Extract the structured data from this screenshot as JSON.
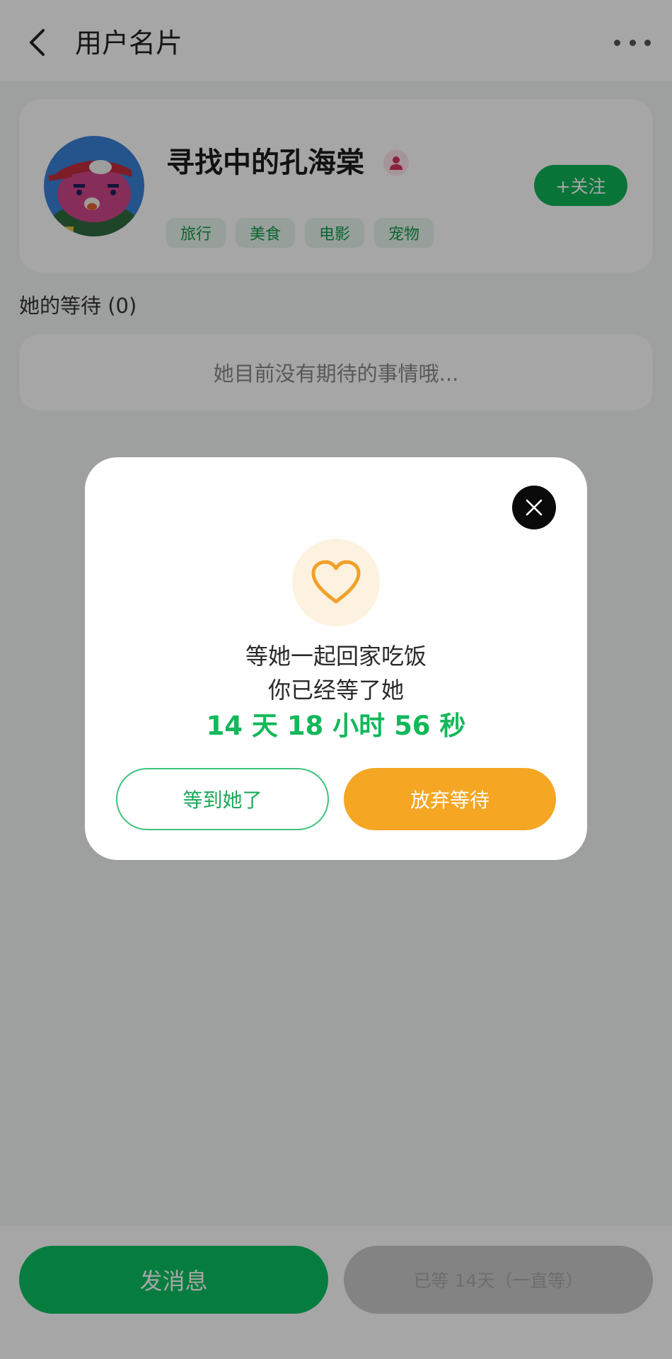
{
  "header": {
    "title": "用户名片",
    "back_icon": "chevron-left-icon",
    "more_icon": "more-horizontal-icon"
  },
  "profile": {
    "username": "寻找中的孔海棠",
    "gender_icon": "female-user-icon",
    "follow_label": "+关注",
    "tags": [
      "旅行",
      "美食",
      "电影",
      "宠物"
    ]
  },
  "waiting_section": {
    "title": "她的等待 (0)",
    "empty_text": "她目前没有期待的事情哦..."
  },
  "bottom": {
    "message_label": "发消息",
    "waiting_label": "已等 14天（一直等）"
  },
  "modal": {
    "close_icon": "close-icon",
    "heart_icon": "heart-icon",
    "line1": "等她一起回家吃饭",
    "line2": "你已经等了她",
    "timer": "14 天 18 小时 56 秒",
    "waited_label": "等到她了",
    "giveup_label": "放弃等待"
  },
  "colors": {
    "primary_green": "#0ac161",
    "timer_green": "#12b85a",
    "accent_orange": "#f5a623",
    "overlay": "rgba(0,0,0,0.35)"
  }
}
